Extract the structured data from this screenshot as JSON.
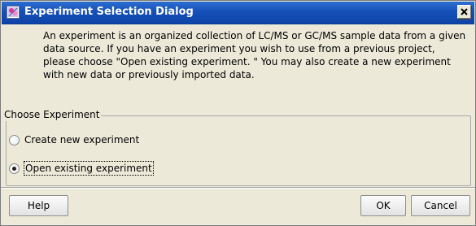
{
  "window": {
    "title": "Experiment Selection Dialog",
    "close_symbol": "x",
    "icon": "experiment-app-icon"
  },
  "info": {
    "text": "An experiment is an organized collection of LC/MS or GC/MS sample data from a given data source. If you have an experiment you wish to use from a previous project, please choose \"Open existing experiment. \" You may also create a new experiment with new data or previously imported data."
  },
  "group": {
    "legend": "Choose Experiment",
    "options": [
      {
        "label": "Create new experiment",
        "selected": false
      },
      {
        "label": "Open existing experiment",
        "selected": true
      }
    ]
  },
  "buttons": {
    "help": "Help",
    "ok": "OK",
    "cancel": "Cancel"
  },
  "colors": {
    "titlebar": "#1650b8",
    "panel": "#ece9d8"
  }
}
